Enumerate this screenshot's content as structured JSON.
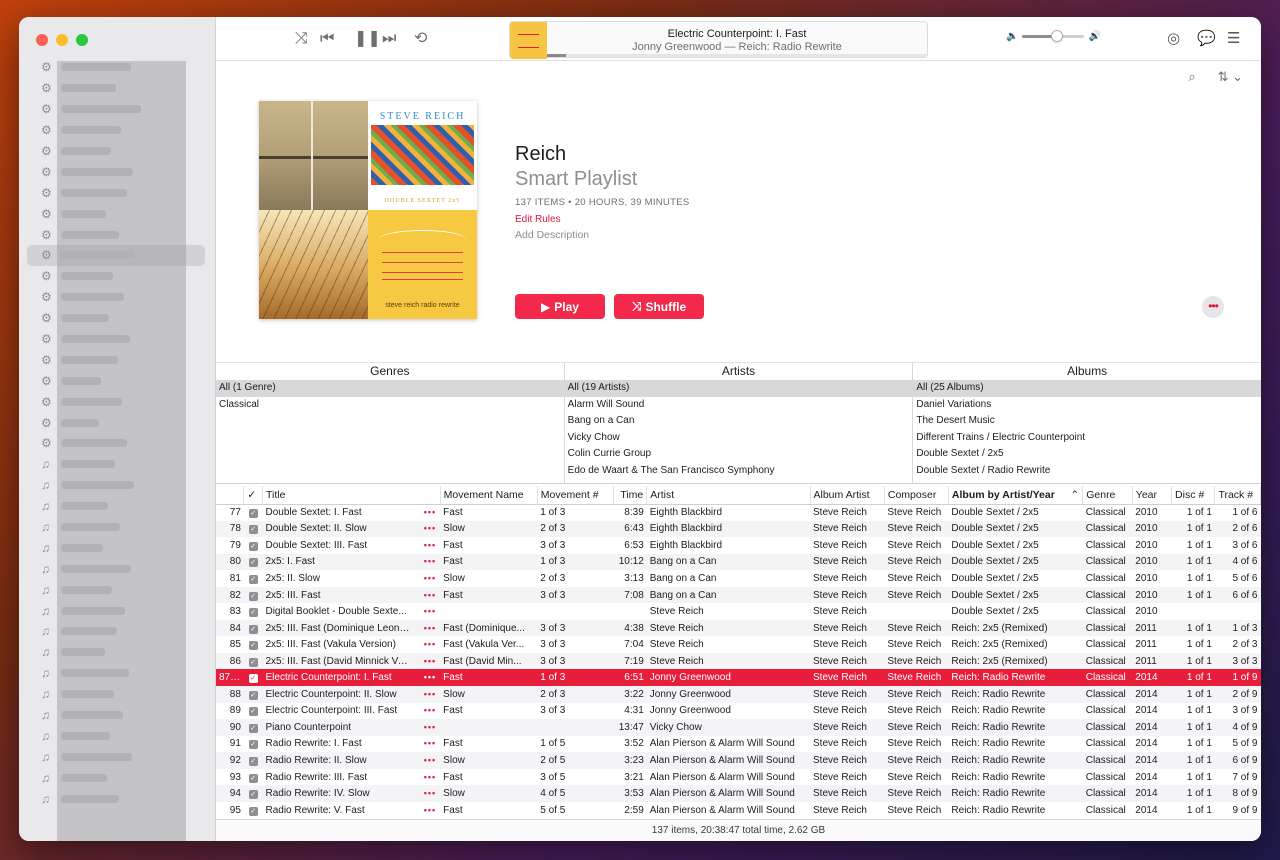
{
  "player": {
    "now_playing_title": "Electric Counterpoint: I. Fast",
    "now_playing_subtitle": "Jonny Greenwood — Reich: Radio Rewrite",
    "progress": 0.05,
    "volume": 0.55
  },
  "playlist": {
    "title": "Reich",
    "type": "Smart Playlist",
    "meta": "137 ITEMS • 20 HOURS, 39 MINUTES",
    "edit_rules": "Edit Rules",
    "add_description": "Add Description",
    "play_label": "Play",
    "shuffle_label": "Shuffle",
    "cover_artist": "STEVE REICH",
    "cover_album": "DOUBLE SEXTET 2x5",
    "cover_caption": "steve reich radio rewrite"
  },
  "browser": {
    "genres": {
      "header": "Genres",
      "items": [
        "All (1 Genre)",
        "Classical"
      ]
    },
    "artists": {
      "header": "Artists",
      "items": [
        "All (19 Artists)",
        "Alarm Will Sound",
        "Bang on a Can",
        "Vicky Chow",
        "Colin Currie Group",
        "Edo de Waart & The San Francisco Symphony"
      ]
    },
    "albums": {
      "header": "Albums",
      "items": [
        "All (25 Albums)",
        "Daniel Variations",
        "The Desert Music",
        "Different Trains / Electric Counterpoint",
        "Double Sextet / 2x5",
        "Double Sextet / Radio Rewrite"
      ]
    }
  },
  "table": {
    "columns": [
      "",
      "✓",
      "Title",
      "Movement Name",
      "Movement #",
      "Time",
      "Artist",
      "Album Artist",
      "Composer",
      "Album by Artist/Year",
      "Genre",
      "Year",
      "Disc #",
      "Track #"
    ],
    "sort_indicator": "⌃",
    "rows": [
      [
        "77",
        "Double Sextet: I. Fast",
        "Fast",
        "1 of 3",
        "8:39",
        "Eighth Blackbird",
        "Steve Reich",
        "Steve Reich",
        "Double Sextet / 2x5",
        "Classical",
        "2010",
        "1 of 1",
        "1 of 6"
      ],
      [
        "78",
        "Double Sextet: II. Slow",
        "Slow",
        "2 of 3",
        "6:43",
        "Eighth Blackbird",
        "Steve Reich",
        "Steve Reich",
        "Double Sextet / 2x5",
        "Classical",
        "2010",
        "1 of 1",
        "2 of 6"
      ],
      [
        "79",
        "Double Sextet: III. Fast",
        "Fast",
        "3 of 3",
        "6:53",
        "Eighth Blackbird",
        "Steve Reich",
        "Steve Reich",
        "Double Sextet / 2x5",
        "Classical",
        "2010",
        "1 of 1",
        "3 of 6"
      ],
      [
        "80",
        "2x5: I. Fast",
        "Fast",
        "1 of 3",
        "10:12",
        "Bang on a Can",
        "Steve Reich",
        "Steve Reich",
        "Double Sextet / 2x5",
        "Classical",
        "2010",
        "1 of 1",
        "4 of 6"
      ],
      [
        "81",
        "2x5: II. Slow",
        "Slow",
        "2 of 3",
        "3:13",
        "Bang on a Can",
        "Steve Reich",
        "Steve Reich",
        "Double Sextet / 2x5",
        "Classical",
        "2010",
        "1 of 1",
        "5 of 6"
      ],
      [
        "82",
        "2x5: III. Fast",
        "Fast",
        "3 of 3",
        "7:08",
        "Bang on a Can",
        "Steve Reich",
        "Steve Reich",
        "Double Sextet / 2x5",
        "Classical",
        "2010",
        "1 of 1",
        "6 of 6"
      ],
      [
        "83",
        "Digital Booklet - Double Sexte...",
        "",
        "",
        "",
        "Steve Reich",
        "Steve Reich",
        "",
        "Double Sextet / 2x5",
        "Classical",
        "2010",
        "",
        ""
      ],
      [
        "84",
        "2x5: III. Fast (Dominique Leone Ver...",
        "Fast (Dominique...",
        "3 of 3",
        "4:38",
        "Steve Reich",
        "Steve Reich",
        "Steve Reich",
        "Reich: 2x5 (Remixed)",
        "Classical",
        "2011",
        "1 of 1",
        "1 of 3"
      ],
      [
        "85",
        "2x5: III. Fast (Vakula Version)",
        "Fast (Vakula Ver...",
        "3 of 3",
        "7:04",
        "Steve Reich",
        "Steve Reich",
        "Steve Reich",
        "Reich: 2x5 (Remixed)",
        "Classical",
        "2011",
        "1 of 1",
        "2 of 3"
      ],
      [
        "86",
        "2x5: III. Fast (David Minnick Version)",
        "Fast (David Min...",
        "3 of 3",
        "7:19",
        "Steve Reich",
        "Steve Reich",
        "Steve Reich",
        "Reich: 2x5 (Remixed)",
        "Classical",
        "2011",
        "1 of 1",
        "3 of 3"
      ],
      [
        "87",
        "Electric Counterpoint: I. Fast",
        "Fast",
        "1 of 3",
        "6:51",
        "Jonny Greenwood",
        "Steve Reich",
        "Steve Reich",
        "Reich: Radio Rewrite",
        "Classical",
        "2014",
        "1 of 1",
        "1 of 9"
      ],
      [
        "88",
        "Electric Counterpoint: II. Slow",
        "Slow",
        "2 of 3",
        "3:22",
        "Jonny Greenwood",
        "Steve Reich",
        "Steve Reich",
        "Reich: Radio Rewrite",
        "Classical",
        "2014",
        "1 of 1",
        "2 of 9"
      ],
      [
        "89",
        "Electric Counterpoint: III. Fast",
        "Fast",
        "3 of 3",
        "4:31",
        "Jonny Greenwood",
        "Steve Reich",
        "Steve Reich",
        "Reich: Radio Rewrite",
        "Classical",
        "2014",
        "1 of 1",
        "3 of 9"
      ],
      [
        "90",
        "Piano Counterpoint",
        "",
        "",
        "13:47",
        "Vicky Chow",
        "Steve Reich",
        "Steve Reich",
        "Reich: Radio Rewrite",
        "Classical",
        "2014",
        "1 of 1",
        "4 of 9"
      ],
      [
        "91",
        "Radio Rewrite: I. Fast",
        "Fast",
        "1 of 5",
        "3:52",
        "Alan Pierson & Alarm Will Sound",
        "Steve Reich",
        "Steve Reich",
        "Reich: Radio Rewrite",
        "Classical",
        "2014",
        "1 of 1",
        "5 of 9"
      ],
      [
        "92",
        "Radio Rewrite: II. Slow",
        "Slow",
        "2 of 5",
        "3:23",
        "Alan Pierson & Alarm Will Sound",
        "Steve Reich",
        "Steve Reich",
        "Reich: Radio Rewrite",
        "Classical",
        "2014",
        "1 of 1",
        "6 of 9"
      ],
      [
        "93",
        "Radio Rewrite: III. Fast",
        "Fast",
        "3 of 5",
        "3:21",
        "Alan Pierson & Alarm Will Sound",
        "Steve Reich",
        "Steve Reich",
        "Reich: Radio Rewrite",
        "Classical",
        "2014",
        "1 of 1",
        "7 of 9"
      ],
      [
        "94",
        "Radio Rewrite: IV. Slow",
        "Slow",
        "4 of 5",
        "3:53",
        "Alan Pierson & Alarm Will Sound",
        "Steve Reich",
        "Steve Reich",
        "Reich: Radio Rewrite",
        "Classical",
        "2014",
        "1 of 1",
        "8 of 9"
      ],
      [
        "95",
        "Radio Rewrite: V. Fast",
        "Fast",
        "5 of 5",
        "2:59",
        "Alan Pierson & Alarm Will Sound",
        "Steve Reich",
        "Steve Reich",
        "Reich: Radio Rewrite",
        "Classical",
        "2014",
        "1 of 1",
        "9 of 9"
      ]
    ],
    "playing_row": "87"
  },
  "status_text": "137 items, 20:38:47 total time, 2.62 GB",
  "colors": {
    "accent": "#e61e3c",
    "button_red": "#f2294a"
  },
  "icons": {
    "shuffle": "shuffle-icon",
    "previous": "previous-icon",
    "pause": "pause-icon",
    "next": "next-icon",
    "repeat": "repeat-icon",
    "airplay": "airplay-icon",
    "lyrics": "lyrics-icon",
    "queue": "queue-list-icon"
  }
}
